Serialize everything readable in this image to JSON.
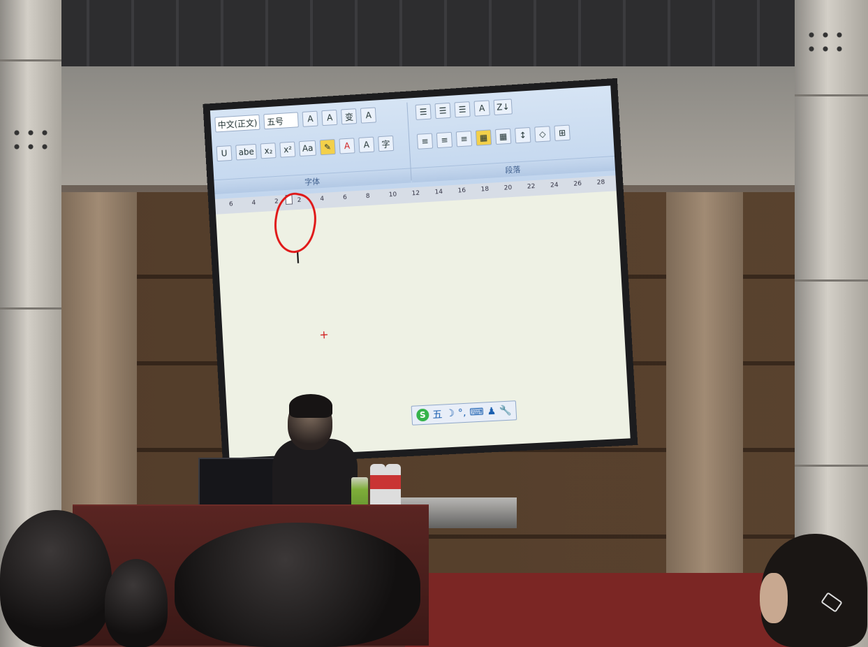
{
  "scene": {
    "description_hidden": "",
    "screen": {
      "app": "word-processor",
      "font_name": "中文(正文)",
      "font_size": "五号",
      "buttons_row1": [
        "A",
        "A",
        "变",
        "A"
      ],
      "buttons_row2": [
        "U",
        "abe",
        "x₂",
        "x²",
        "Aa",
        "A",
        "A",
        "字"
      ],
      "para_row1": [
        "☰",
        "☰",
        "☰",
        "A",
        "Z↓"
      ],
      "para_row2": [
        "≡",
        "≡",
        "≡",
        "▦",
        "▦",
        "↕",
        "◇",
        "⊞"
      ],
      "group_font_label": "字体",
      "group_para_label": "段落",
      "ruler_ticks": [
        "6",
        "4",
        "2",
        "2",
        "4",
        "6",
        "8",
        "10",
        "12",
        "14",
        "16",
        "18",
        "20",
        "22",
        "24",
        "26",
        "28"
      ],
      "ime_bar": {
        "s_icon": "S",
        "items": [
          "五",
          "☽",
          "°,",
          "⌨",
          "♟",
          "🔧"
        ]
      }
    },
    "colors": {
      "annotation": "#e01818",
      "ribbon": "#c2d6ee",
      "document": "#eef1e4",
      "carpet": "#7b2624"
    }
  }
}
